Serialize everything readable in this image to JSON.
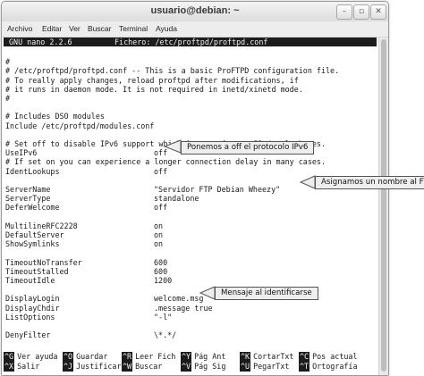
{
  "window": {
    "title": "usuario@debian: ~",
    "controls": [
      "–",
      "▫",
      "✕"
    ]
  },
  "menubar": [
    "Archivo",
    "Editar",
    "Ver",
    "Buscar",
    "Terminal",
    "Ayuda"
  ],
  "nano": {
    "version": "GNU nano 2.2.6",
    "file": "Fichero: /etc/proftpd/proftpd.conf"
  },
  "lines": [
    {
      "text": ""
    },
    {
      "text": "#"
    },
    {
      "text": "# /etc/proftpd/proftpd.conf -- This is a basic ProFTPD configuration file."
    },
    {
      "text": "# To really apply changes, reload proftpd after modifications, if"
    },
    {
      "text": "# it runs in daemon mode. It is not required in inetd/xinetd mode."
    },
    {
      "text": "#"
    },
    {
      "text": ""
    },
    {
      "text": "# Includes DSO modules"
    },
    {
      "text": "Include /etc/proftpd/modules.conf"
    },
    {
      "text": ""
    },
    {
      "text": "# Set off to disable IPv6 support which is annoying on IPv4 only boxes."
    },
    {
      "text": "UseIPv6",
      "value": "off"
    },
    {
      "text": "# If set on you can experience a longer connection delay in many cases."
    },
    {
      "text": "IdentLookups",
      "value": "off"
    },
    {
      "text": ""
    },
    {
      "text": "ServerName",
      "value": "\"Servidor FTP Debian Wheezy\""
    },
    {
      "text": "ServerType",
      "value": "standalone"
    },
    {
      "text": "DeferWelcome",
      "value": "off"
    },
    {
      "text": ""
    },
    {
      "text": "MultilineRFC2228",
      "value": "on"
    },
    {
      "text": "DefaultServer",
      "value": "on"
    },
    {
      "text": "ShowSymlinks",
      "value": "on"
    },
    {
      "text": ""
    },
    {
      "text": "TimeoutNoTransfer",
      "value": "600"
    },
    {
      "text": "TimeoutStalled",
      "value": "600"
    },
    {
      "text": "TimeoutIdle",
      "value": "1200"
    },
    {
      "text": ""
    },
    {
      "text": "DisplayLogin",
      "value": "welcome.msg"
    },
    {
      "text": "DisplayChdir",
      "value": ".message true"
    },
    {
      "text": "ListOptions",
      "value": "\"-l\""
    },
    {
      "text": ""
    },
    {
      "text": "DenyFilter",
      "value": "\\*.*/"
    }
  ],
  "shortcuts_row1": [
    {
      "key": "^G",
      "label": "Ver ayuda"
    },
    {
      "key": "^O",
      "label": "Guardar"
    },
    {
      "key": "^R",
      "label": "Leer Fich"
    },
    {
      "key": "^Y",
      "label": "Pág Ant"
    },
    {
      "key": "^K",
      "label": "CortarTxt"
    },
    {
      "key": "^C",
      "label": "Pos actual"
    }
  ],
  "shortcuts_row2": [
    {
      "key": "^X",
      "label": "Salir"
    },
    {
      "key": "^J",
      "label": "Justificar"
    },
    {
      "key": "^W",
      "label": "Buscar"
    },
    {
      "key": "^V",
      "label": "Pág Sig"
    },
    {
      "key": "^U",
      "label": "PegarTxt"
    },
    {
      "key": "^T",
      "label": "Ortografía"
    }
  ],
  "annotations": {
    "ipv6": "Ponemos a off el protocolo IPv6",
    "servername": "Asignamos un nombre al FTP",
    "welcome": "Mensaje al identificarse"
  }
}
